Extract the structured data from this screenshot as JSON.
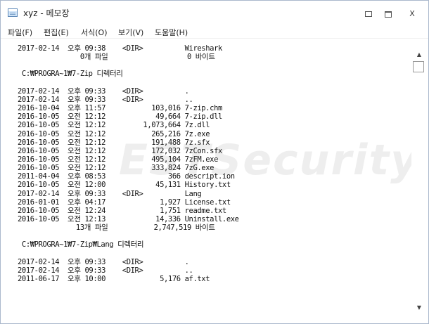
{
  "window": {
    "title": "xyz - 메모장",
    "icon": "notepad-icon",
    "controls": [
      "minimize-icon",
      "maximize-icon",
      "close-icon"
    ],
    "close_label": "X"
  },
  "menu": [
    {
      "label": "파일(F)"
    },
    {
      "label": "편집(E)"
    },
    {
      "label": "서식(O)"
    },
    {
      "label": "보기(V)"
    },
    {
      "label": "도움말(H)"
    }
  ],
  "lines": [
    "2017-02-14  오후 09:38    <DIR>          Wireshark",
    "               0개 파일                   0 바이트",
    "",
    " C:₩PROGRA~1₩7-Zip 디렉터리",
    "",
    "2017-02-14  오후 09:33    <DIR>          .",
    "2017-02-14  오후 09:33    <DIR>          ..",
    "2016-10-04  오후 11:57           103,016 7-zip.chm",
    "2016-10-05  오전 12:12            49,664 7-zip.dll",
    "2016-10-05  오전 12:12         1,073,664 7z.dll",
    "2016-10-05  오전 12:12           265,216 7z.exe",
    "2016-10-05  오전 12:12           191,488 7z.sfx",
    "2016-10-05  오전 12:12           172,032 7zCon.sfx",
    "2016-10-05  오전 12:12           495,104 7zFM.exe",
    "2016-10-05  오전 12:12           333,824 7zG.exe",
    "2011-04-04  오후 08:53               366 descript.ion",
    "2016-10-05  오전 12:00            45,131 History.txt",
    "2017-02-14  오후 09:33    <DIR>          Lang",
    "2016-01-01  오후 04:17             1,927 License.txt",
    "2016-10-05  오전 12:24             1,751 readme.txt",
    "2016-10-05  오전 12:13            14,336 Uninstall.exe",
    "              13개 파일           2,747,519 바이트",
    "",
    " C:₩PROGRA~1₩7-Zip₩Lang 디렉터리",
    "",
    "2017-02-14  오후 09:33    <DIR>          .",
    "2017-02-14  오후 09:33    <DIR>          ..",
    "2011-06-17  오후 10:00             5,176 af.txt"
  ],
  "watermark": "EST",
  "watermark_tail": "urity",
  "scrollbar": {
    "up": "▲",
    "down": "▼"
  }
}
